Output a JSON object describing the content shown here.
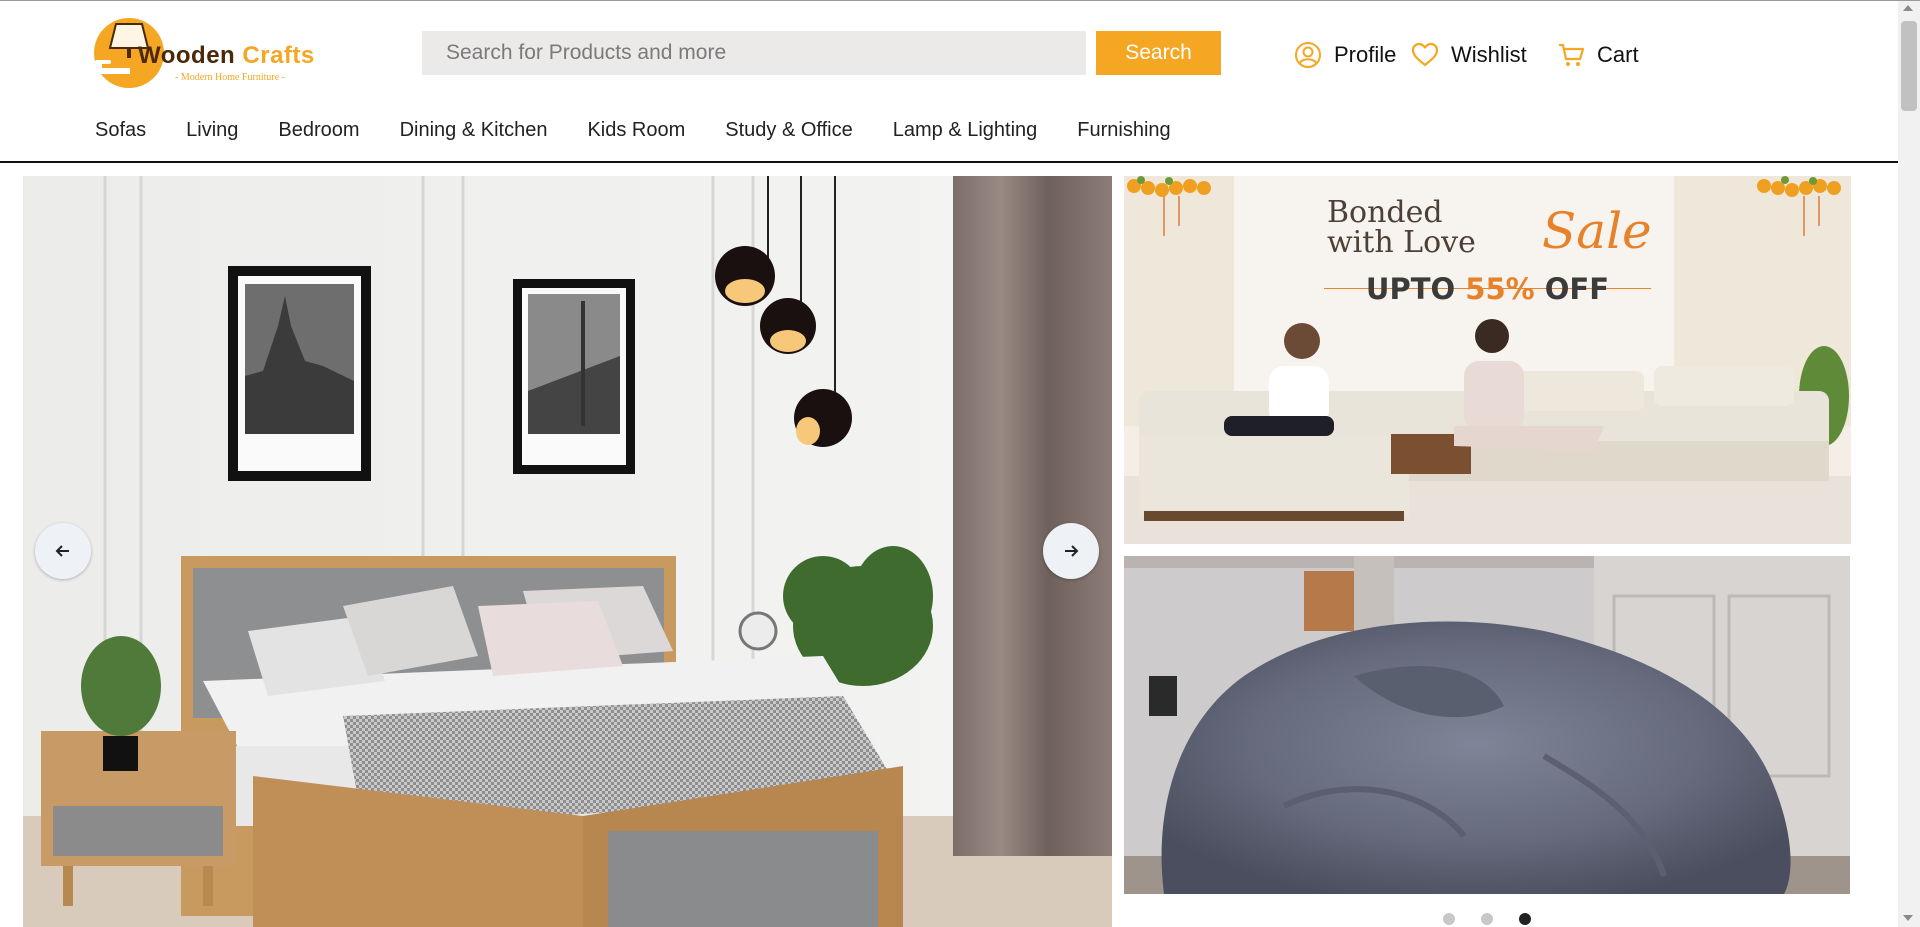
{
  "brand": {
    "name_part1": "Wooden",
    "name_part2": "Crafts",
    "tagline": "- Modern Home Furniture -",
    "logo_icon": "lamp-sofa-logo",
    "colors": {
      "accent": "#f5a623",
      "dark": "#4a2808"
    }
  },
  "search": {
    "placeholder": "Search for Products and more",
    "value": "",
    "button_label": "Search"
  },
  "header_links": [
    {
      "label": "Profile",
      "icon": "user-circle-icon"
    },
    {
      "label": "Wishlist",
      "icon": "heart-icon"
    },
    {
      "label": "Cart",
      "icon": "cart-icon"
    }
  ],
  "categories": [
    "Sofas",
    "Living",
    "Bedroom",
    "Dining & Kitchen",
    "Kids Room",
    "Study & Office",
    "Lamp & Lighting",
    "Furnishing"
  ],
  "hero": {
    "main_image": "bedroom-bed-banner",
    "prev_icon": "arrow-left-icon",
    "next_icon": "arrow-right-icon",
    "active_slide": 3,
    "slide_count": 3
  },
  "promo": {
    "line1": "Bonded",
    "line2": "with Love",
    "sale_word": "Sale",
    "offer_prefix": "UPTO ",
    "offer_percent": "55%",
    "offer_suffix": " OFF",
    "second_image": "bean-bag-banner"
  }
}
